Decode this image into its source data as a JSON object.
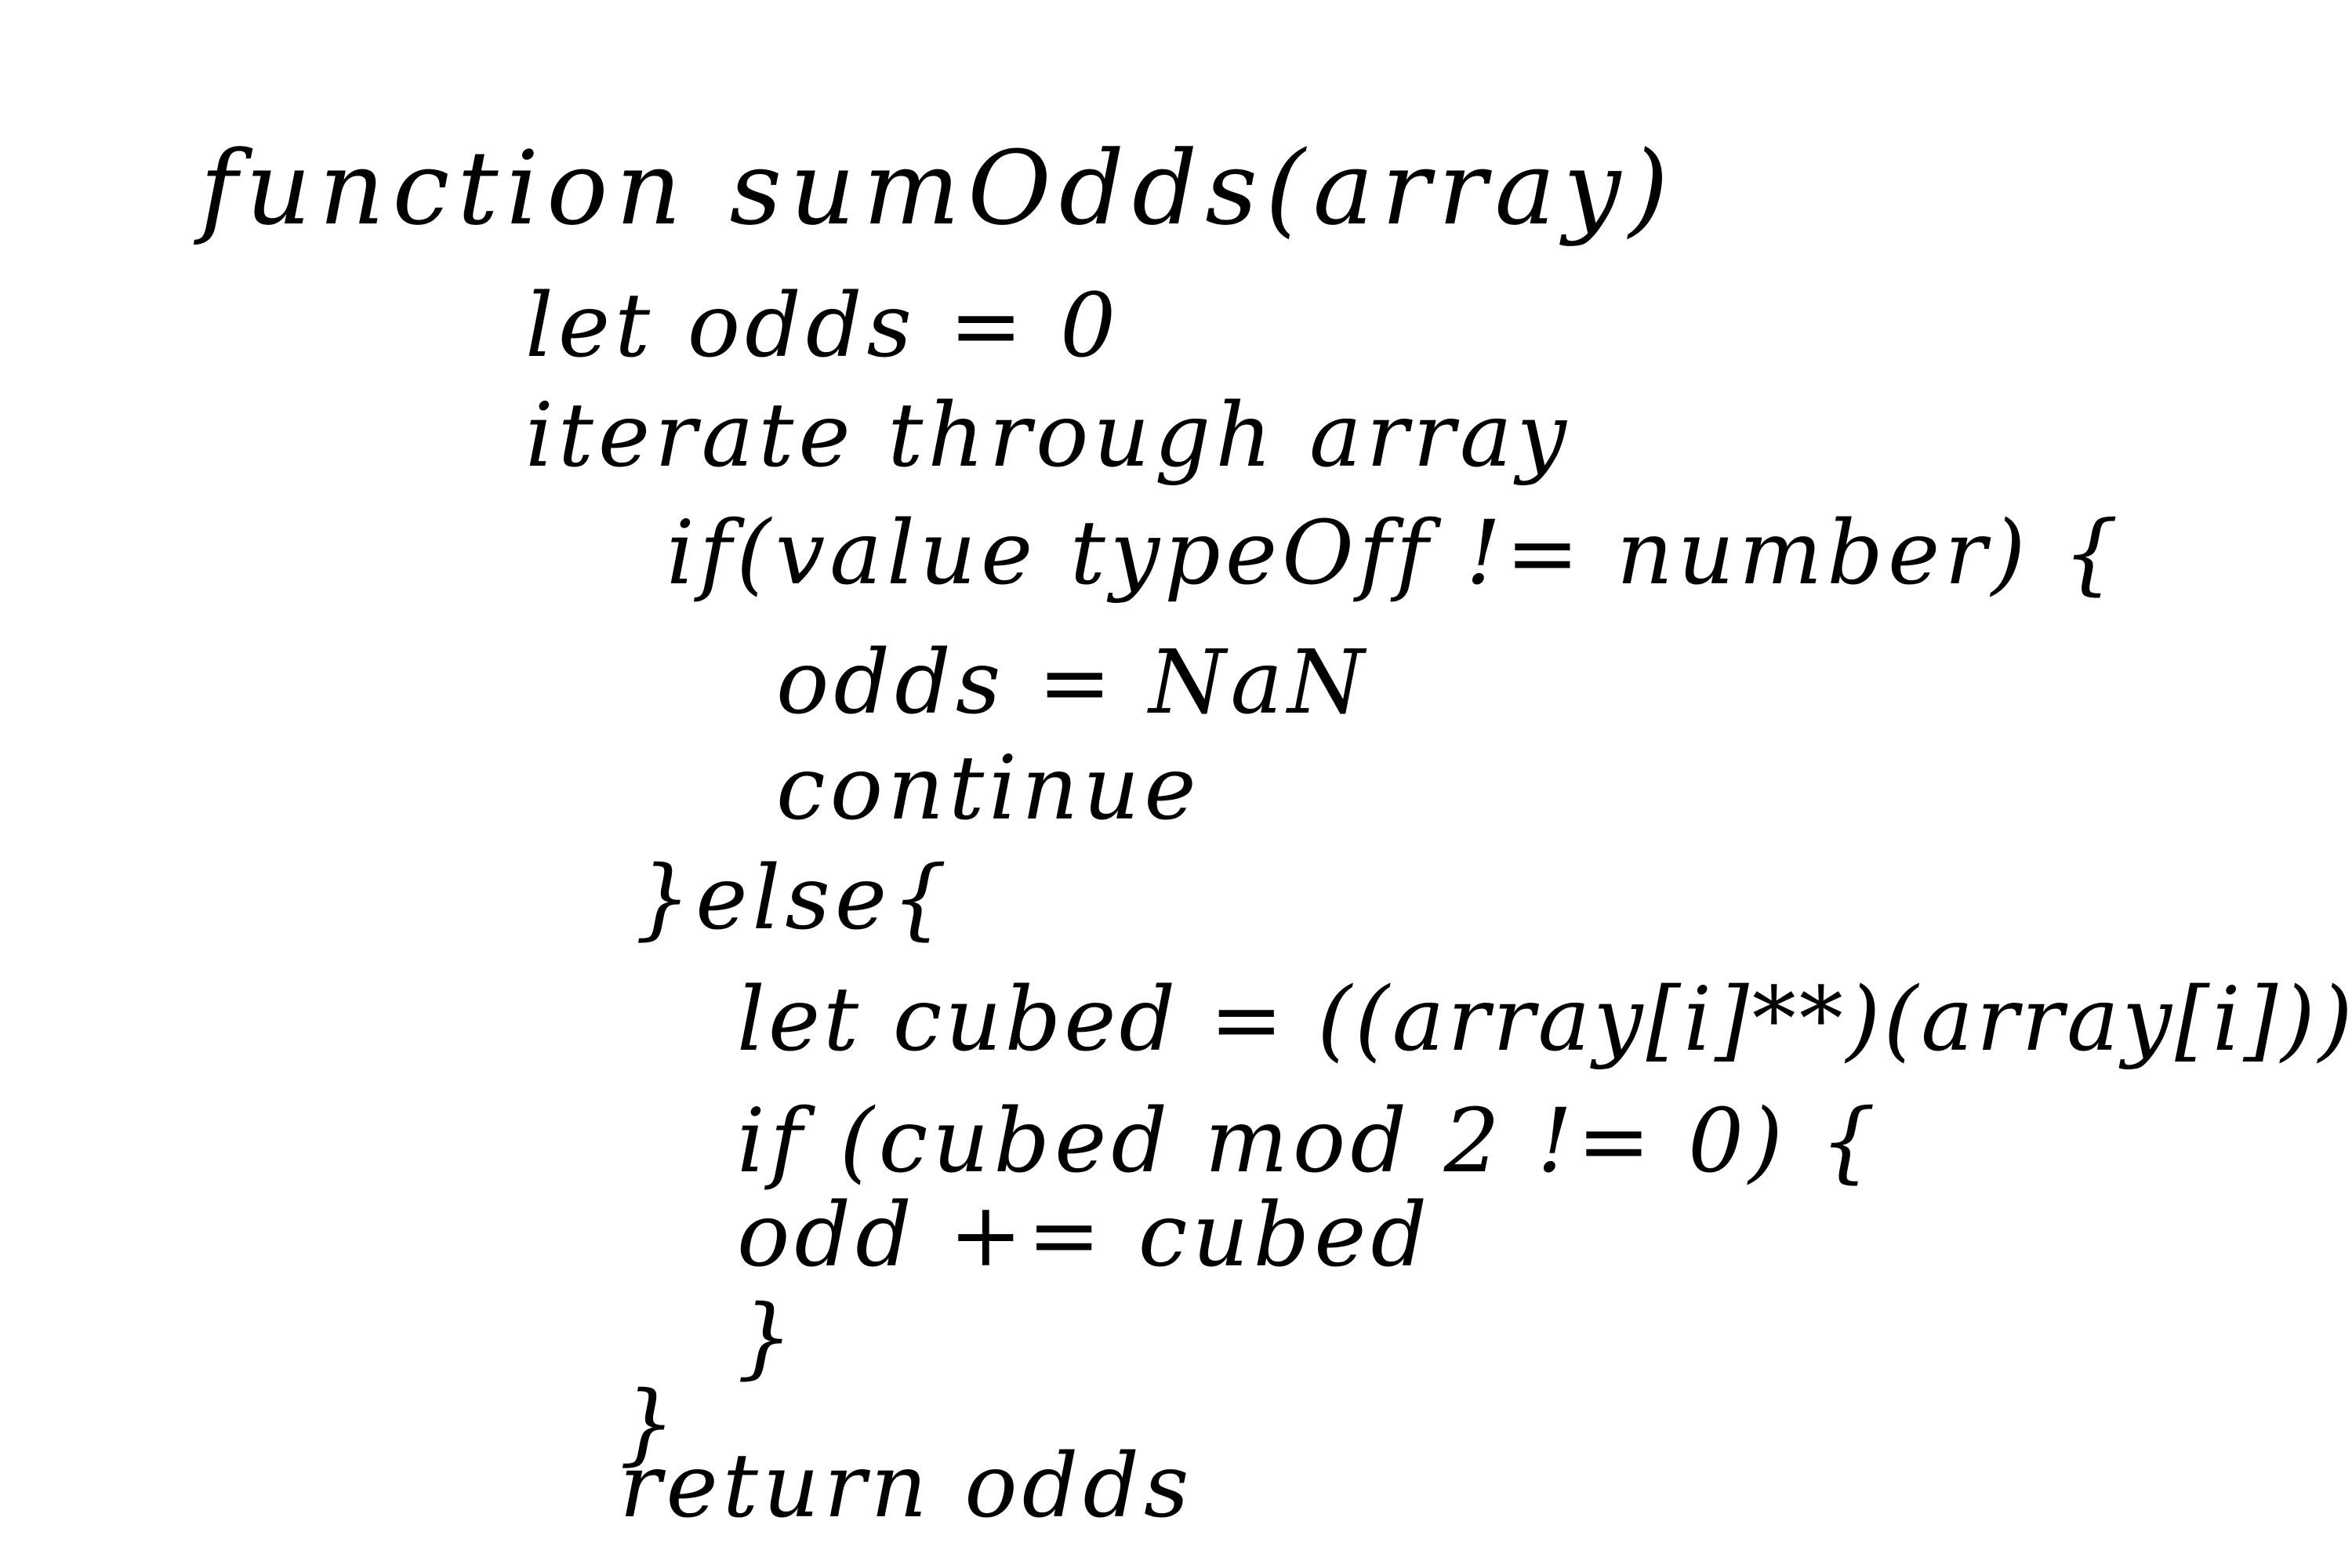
{
  "code": {
    "lines": [
      "function sumOdds(array)",
      "let odds = 0",
      "iterate through array",
      "if(value typeOff != number) {",
      "odds = NaN",
      "continue",
      "}else{",
      "let cubed = ((array[i]**)(array[i]))",
      "if (cubed mod 2 != 0) {",
      "odd += cubed",
      "}",
      "}",
      "return odds"
    ]
  },
  "colors": {
    "ink": "#000000",
    "paper": "#ffffff"
  }
}
